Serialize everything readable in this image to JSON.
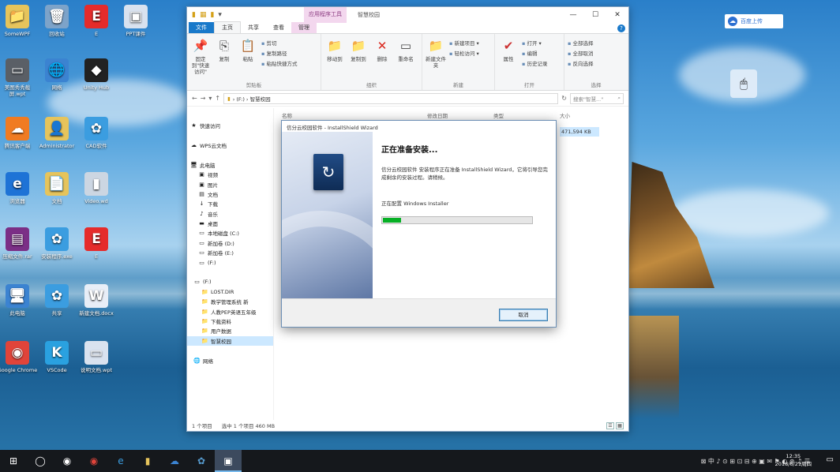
{
  "desktop": {
    "icons": [
      {
        "label": "SomeWPF",
        "glyph": "📁",
        "bg": "#e6c45c"
      },
      {
        "label": "回收站",
        "glyph": "🗑",
        "bg": "#7da3c9"
      },
      {
        "label": "E",
        "glyph": "E",
        "bg": "#e52b2b"
      },
      {
        "label": "PPT课件",
        "glyph": "▣",
        "bg": "#d9e2ef"
      },
      {
        "label": "美图秀秀截屏.wpt",
        "glyph": "▭",
        "bg": "#5a5f66"
      },
      {
        "label": "网络",
        "glyph": "🌐",
        "bg": "#3b83d1"
      },
      {
        "label": "Unity Hub",
        "glyph": "◆",
        "bg": "#222"
      },
      {
        "label": "腾讯客户端",
        "glyph": "☁",
        "bg": "#f07b22"
      },
      {
        "label": "Administrator",
        "glyph": "👤",
        "bg": "#e6c45c"
      },
      {
        "label": "CAD软件",
        "glyph": "✿",
        "bg": "#3b9de0"
      },
      {
        "label": "浏览器",
        "glyph": "e",
        "bg": "#1e73d6"
      },
      {
        "label": "文档",
        "glyph": "📄",
        "bg": "#e6c45c"
      },
      {
        "label": "Video.wd",
        "glyph": "▮",
        "bg": "#ccd6e2"
      },
      {
        "label": "压缩文件.rar",
        "glyph": "▤",
        "bg": "#7b2f86"
      },
      {
        "label": "安装程序.exe",
        "glyph": "✿",
        "bg": "#3b9de0"
      },
      {
        "label": "E",
        "glyph": "E",
        "bg": "#e52b2b"
      },
      {
        "label": "此电脑",
        "glyph": "🖥",
        "bg": "#3b83d1"
      },
      {
        "label": "共享",
        "glyph": "✿",
        "bg": "#3b9de0"
      },
      {
        "label": "新建文档.docx",
        "glyph": "W",
        "bg": "#e8eef7"
      },
      {
        "label": "Google Chrome",
        "glyph": "◉",
        "bg": "#e0443a"
      },
      {
        "label": "VSCode",
        "glyph": "K",
        "bg": "#2aa1e0"
      },
      {
        "label": "说明文档.wpt",
        "glyph": "▭",
        "bg": "#d9e2ef"
      }
    ],
    "cloud_widget": {
      "label": "百度上传",
      "icon": "cloud-icon"
    },
    "mouse_widget": {
      "icon": "mouse-icon"
    }
  },
  "explorer": {
    "context_tab": "应用程序工具",
    "window_title": "智慧校园",
    "tabs": [
      "文件",
      "主页",
      "共享",
      "查看",
      "管理"
    ],
    "ribbon": {
      "clipboard": {
        "name": "剪贴板",
        "pin": "固定到\"快速访问\"",
        "copy": "复制",
        "paste": "粘贴",
        "cut": "剪切",
        "copy_path": "复制路径",
        "paste_shortcut": "粘贴快捷方式"
      },
      "organize": {
        "name": "组织",
        "move": "移动到",
        "copyto": "复制到",
        "delete": "删除",
        "rename": "重命名"
      },
      "new": {
        "name": "新建",
        "folder": "新建文件夹",
        "item": "新建项目 ▾",
        "easy": "轻松访问 ▾"
      },
      "open": {
        "name": "打开",
        "props": "属性",
        "open": "打开 ▾",
        "edit": "编辑",
        "history": "历史记录"
      },
      "select": {
        "name": "选择",
        "all": "全部选择",
        "none": "全部取消",
        "invert": "反向选择"
      }
    },
    "address": {
      "path": "› (F:) › 智慧校园",
      "search_placeholder": "搜索\"智慧...\""
    },
    "nav": [
      {
        "label": "快速访问",
        "icon": "★"
      },
      {
        "label": "",
        "icon": ""
      },
      {
        "label": "WPS云文档",
        "icon": "☁"
      },
      {
        "label": "",
        "icon": ""
      },
      {
        "label": "此电脑",
        "icon": "🖥"
      },
      {
        "label": "视频",
        "icon": "▣"
      },
      {
        "label": "图片",
        "icon": "▣"
      },
      {
        "label": "文档",
        "icon": "▤"
      },
      {
        "label": "下载",
        "icon": "↓"
      },
      {
        "label": "音乐",
        "icon": "♪"
      },
      {
        "label": "桌面",
        "icon": "▬"
      },
      {
        "label": "本地磁盘 (C:)",
        "icon": "▭"
      },
      {
        "label": "新加卷 (D:)",
        "icon": "▭"
      },
      {
        "label": "新加卷 (E:)",
        "icon": "▭"
      },
      {
        "label": "(F:)",
        "icon": "▭"
      },
      {
        "label": "",
        "icon": ""
      },
      {
        "label": "(F:)",
        "icon": "▭"
      },
      {
        "label": "LOST.DIR",
        "icon": "📁"
      },
      {
        "label": "教学管理系统 新",
        "icon": "📁"
      },
      {
        "label": "人教PEP英语五年级",
        "icon": "📁"
      },
      {
        "label": "下载资料",
        "icon": "📁"
      },
      {
        "label": "用户数据",
        "icon": "📁"
      },
      {
        "label": "智慧校园",
        "icon": "📁"
      },
      {
        "label": "",
        "icon": ""
      },
      {
        "label": "网络",
        "icon": "🌐"
      }
    ],
    "columns": [
      "名称",
      "修改日期",
      "类型",
      "大小"
    ],
    "size_value": "471,594 KB",
    "status": {
      "count": "1 个项目",
      "selected": "选中 1 个项目 460 MB"
    }
  },
  "installer": {
    "title": "信分云校园软件 - InstallShield Wizard",
    "heading": "正在准备安装...",
    "description": "信分云校园软件 安装程序正在准备 InstallShield Wizard，它将引导您完成剩余的安装过程。请稍候。",
    "status": "正在配置 Windows Installer",
    "progress": 0.12,
    "cancel_label": "取消"
  },
  "taskbar": {
    "icons": [
      "windows-icon",
      "task-view-icon",
      "app-icon",
      "chrome-icon",
      "ie-icon",
      "explorer-icon",
      "cloud-app-icon",
      "installer-app-icon",
      "wizard-icon"
    ],
    "tray": "⊠ 中 ♪ ⊙ ⊞ ⊡ ⊟ ⊕ ▣ ✉ ⚑ ◐ ⊛ ♫ ☰",
    "time": "12:35",
    "date": "2018/6/21周四",
    "colors": {
      "accent": "#1979ca",
      "progress": "#06b025",
      "taskbar": "#15181c"
    }
  }
}
